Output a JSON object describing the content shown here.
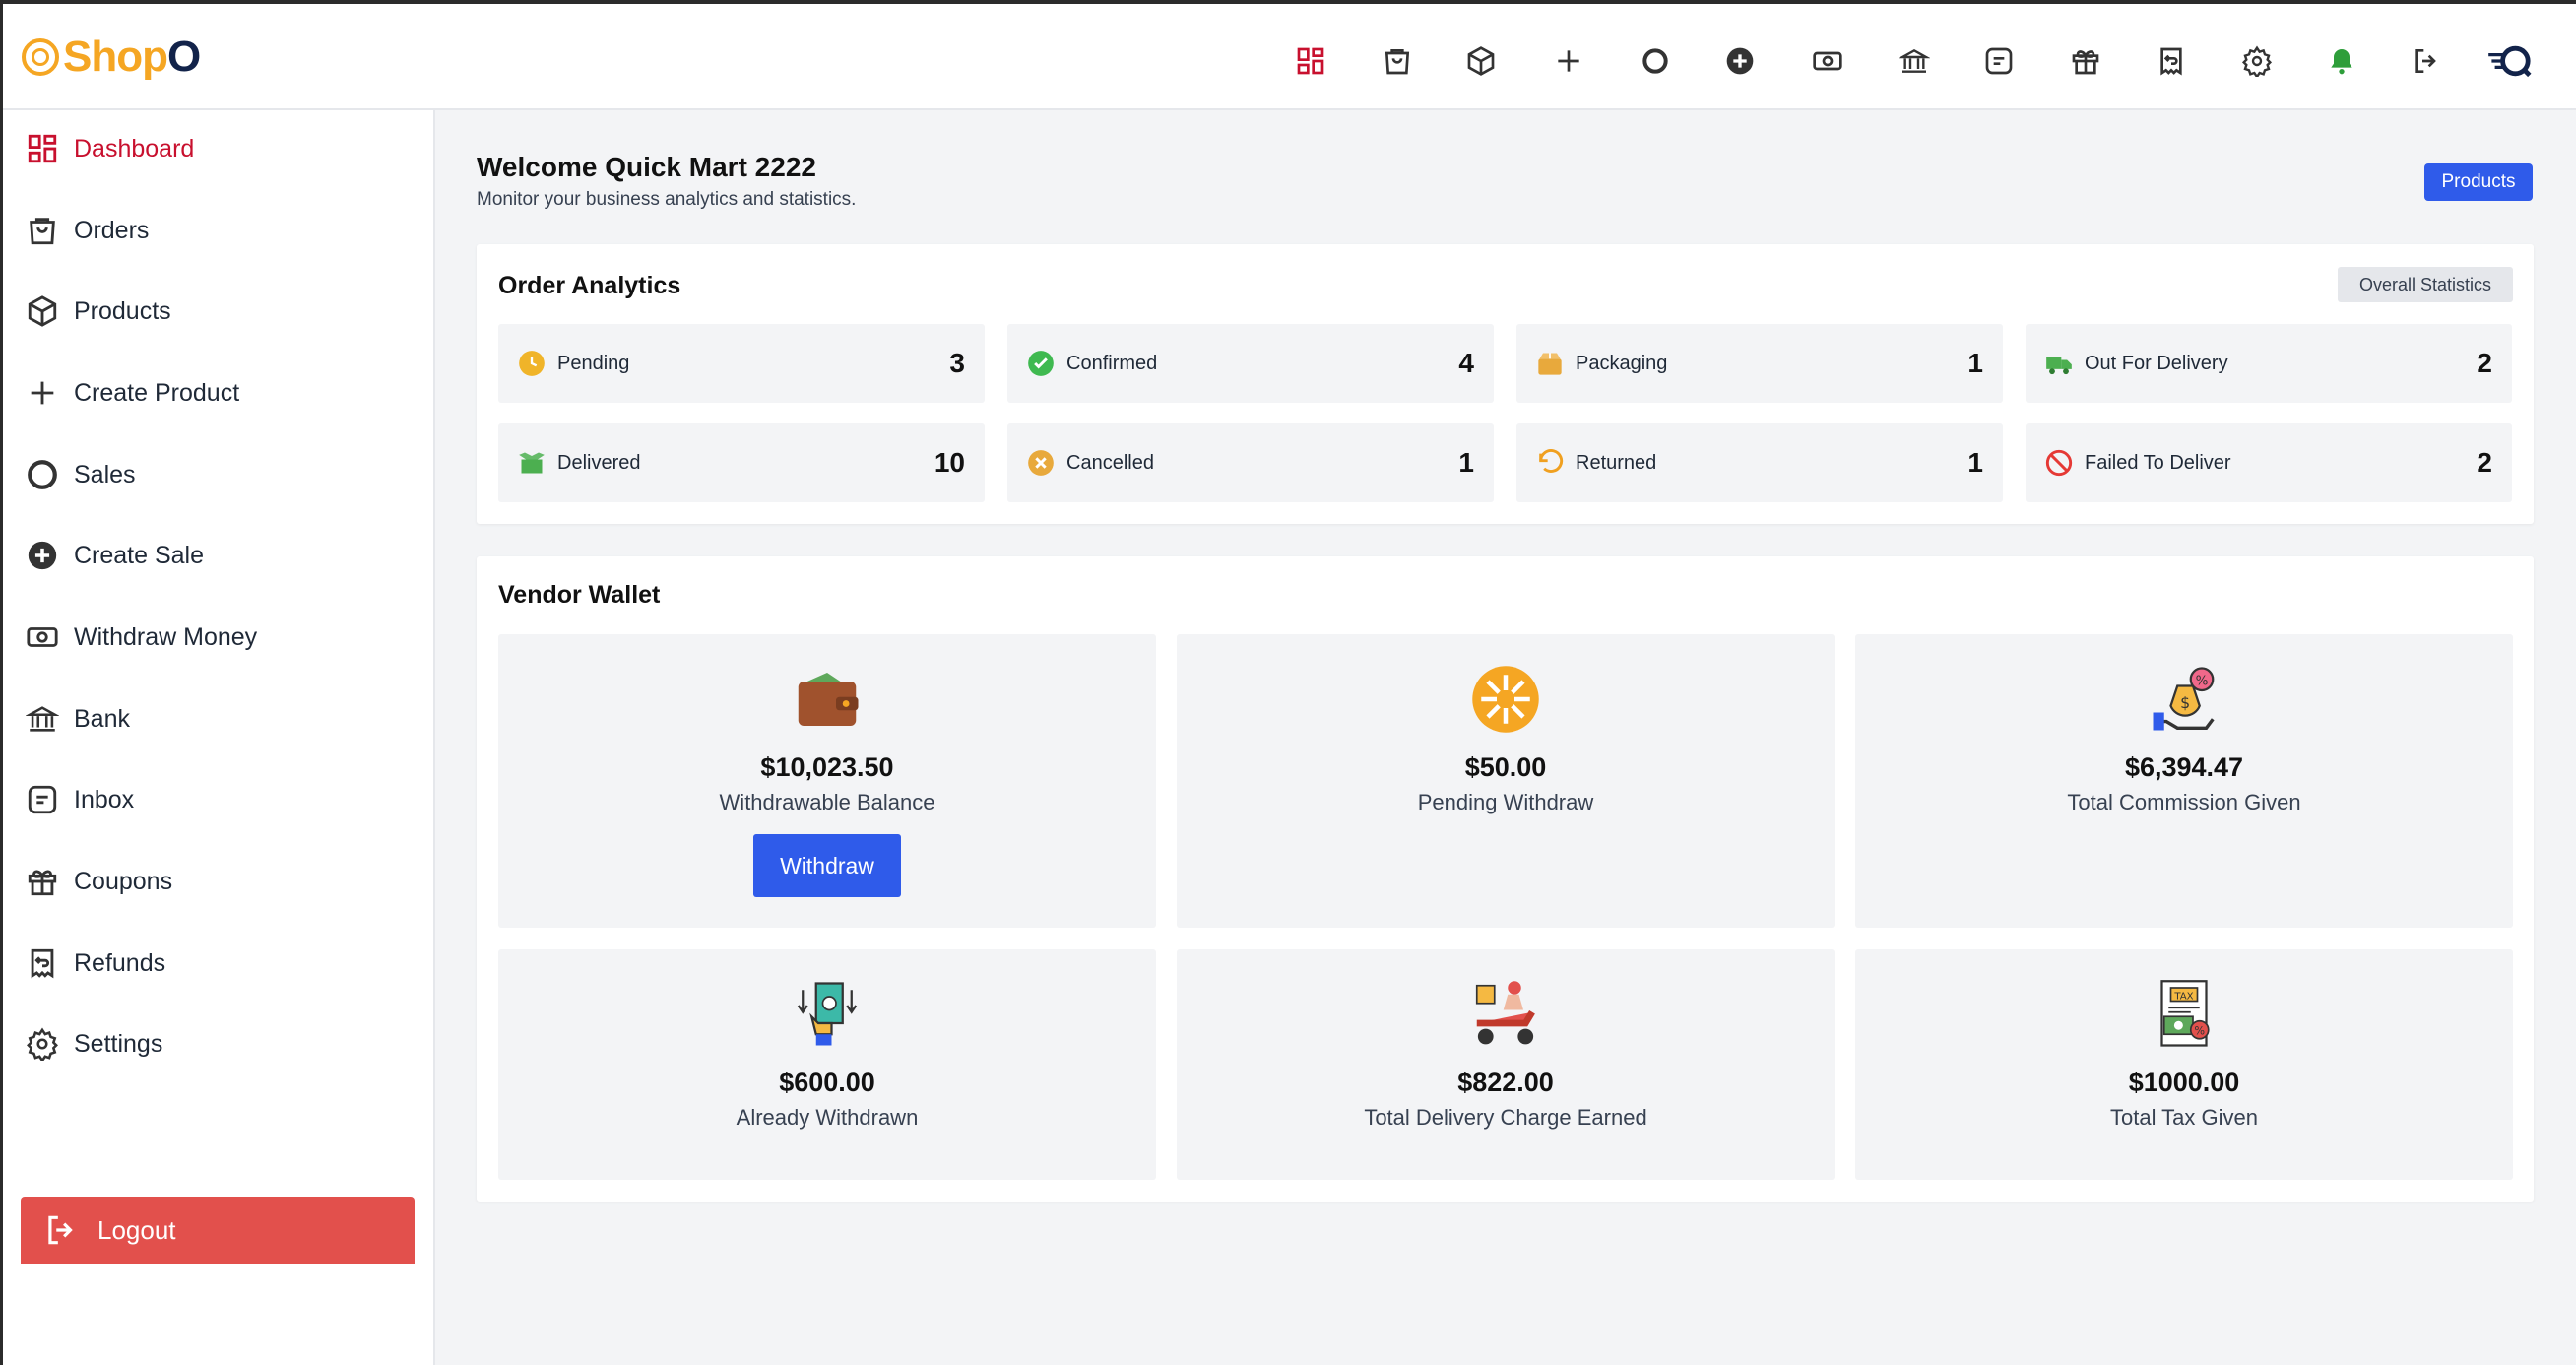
{
  "brand": {
    "logo_text_1": "Shop",
    "logo_text_2": "O"
  },
  "topnav": {
    "icons": [
      "dashboard-icon",
      "orders-icon",
      "products-icon",
      "create-product-icon",
      "sales-icon",
      "create-sale-icon",
      "withdraw-money-icon",
      "bank-icon",
      "inbox-icon",
      "coupons-icon",
      "refunds-icon",
      "settings-icon",
      "notification-bell-icon",
      "logout-icon",
      "account-avatar-icon"
    ]
  },
  "sidebar": {
    "items": [
      {
        "label": "Dashboard",
        "icon": "dashboard-icon",
        "active": true
      },
      {
        "label": "Orders",
        "icon": "orders-icon"
      },
      {
        "label": "Products",
        "icon": "products-icon"
      },
      {
        "label": "Create Product",
        "icon": "plus-icon"
      },
      {
        "label": "Sales",
        "icon": "sales-icon"
      },
      {
        "label": "Create Sale",
        "icon": "plus-circle-icon"
      },
      {
        "label": "Withdraw Money",
        "icon": "cash-icon"
      },
      {
        "label": "Bank",
        "icon": "bank-icon"
      },
      {
        "label": "Inbox",
        "icon": "inbox-icon"
      },
      {
        "label": "Coupons",
        "icon": "gift-icon"
      },
      {
        "label": "Refunds",
        "icon": "refund-icon"
      },
      {
        "label": "Settings",
        "icon": "gear-icon"
      }
    ],
    "logout_label": "Logout"
  },
  "main": {
    "welcome_title": "Welcome Quick Mart 2222",
    "welcome_subtitle": "Monitor your business analytics and statistics.",
    "products_button": "Products"
  },
  "order_analytics": {
    "title": "Order Analytics",
    "overall_button": "Overall Statistics",
    "stats": [
      {
        "label": "Pending",
        "count": "3",
        "icon": "clock-icon",
        "color": "#f0b429"
      },
      {
        "label": "Confirmed",
        "count": "4",
        "icon": "check-circle-icon",
        "color": "#3fb950"
      },
      {
        "label": "Packaging",
        "count": "1",
        "icon": "package-icon",
        "color": "#e8a93c"
      },
      {
        "label": "Out For Delivery",
        "count": "2",
        "icon": "truck-icon",
        "color": "#4caf50"
      },
      {
        "label": "Delivered",
        "count": "10",
        "icon": "delivered-box-icon",
        "color": "#4caf50"
      },
      {
        "label": "Cancelled",
        "count": "1",
        "icon": "x-circle-icon",
        "color": "#e8a93c"
      },
      {
        "label": "Returned",
        "count": "1",
        "icon": "undo-icon",
        "color": "#f0a020"
      },
      {
        "label": "Failed To Deliver",
        "count": "2",
        "icon": "ban-icon",
        "color": "#e53935"
      }
    ]
  },
  "vendor_wallet": {
    "title": "Vendor Wallet",
    "boxes": [
      {
        "amount": "$10,023.50",
        "label": "Withdrawable Balance",
        "icon": "wallet-icon"
      },
      {
        "amount": "$50.00",
        "label": "Pending Withdraw",
        "icon": "pending-sun-icon"
      },
      {
        "amount": "$6,394.47",
        "label": "Total Commission Given",
        "icon": "commission-money-bag-icon"
      },
      {
        "amount": "$600.00",
        "label": "Already Withdrawn",
        "icon": "cash-withdrawn-icon"
      },
      {
        "amount": "$822.00",
        "label": "Total Delivery Charge Earned",
        "icon": "delivery-scooter-icon"
      },
      {
        "amount": "$1000.00",
        "label": "Total Tax Given",
        "icon": "tax-document-icon"
      }
    ],
    "withdraw_button": "Withdraw"
  }
}
